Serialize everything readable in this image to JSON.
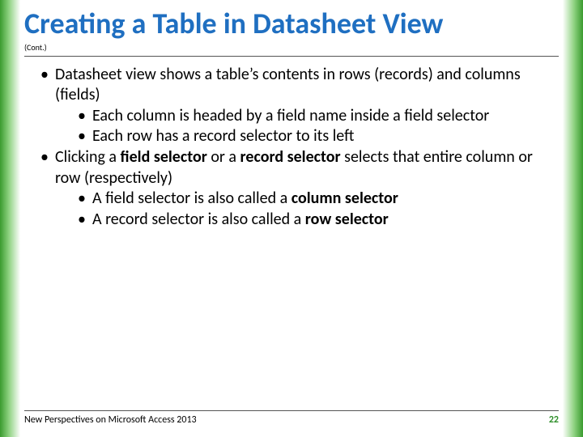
{
  "title": "Creating a Table in Datasheet View",
  "cont": "(Cont.)",
  "bullets": {
    "b1_pre": "Datasheet view shows a table’s contents in rows (records) and columns (fields)",
    "b1s1": "Each column is headed by a field name inside a field selector",
    "b1s2": "Each row has a record selector to its left",
    "b2_pre": "Clicking a ",
    "b2_bold1": "field selector",
    "b2_mid": " or a ",
    "b2_bold2": "record selector",
    "b2_post": " selects that entire column or row (respectively)",
    "b2s1_pre": "A field selector is also called a ",
    "b2s1_bold": "column selector",
    "b2s2_pre": "A record selector is also called a ",
    "b2s2_bold": "row selector"
  },
  "footer": {
    "left": "New Perspectives on Microsoft Access 2013",
    "page": "22"
  }
}
